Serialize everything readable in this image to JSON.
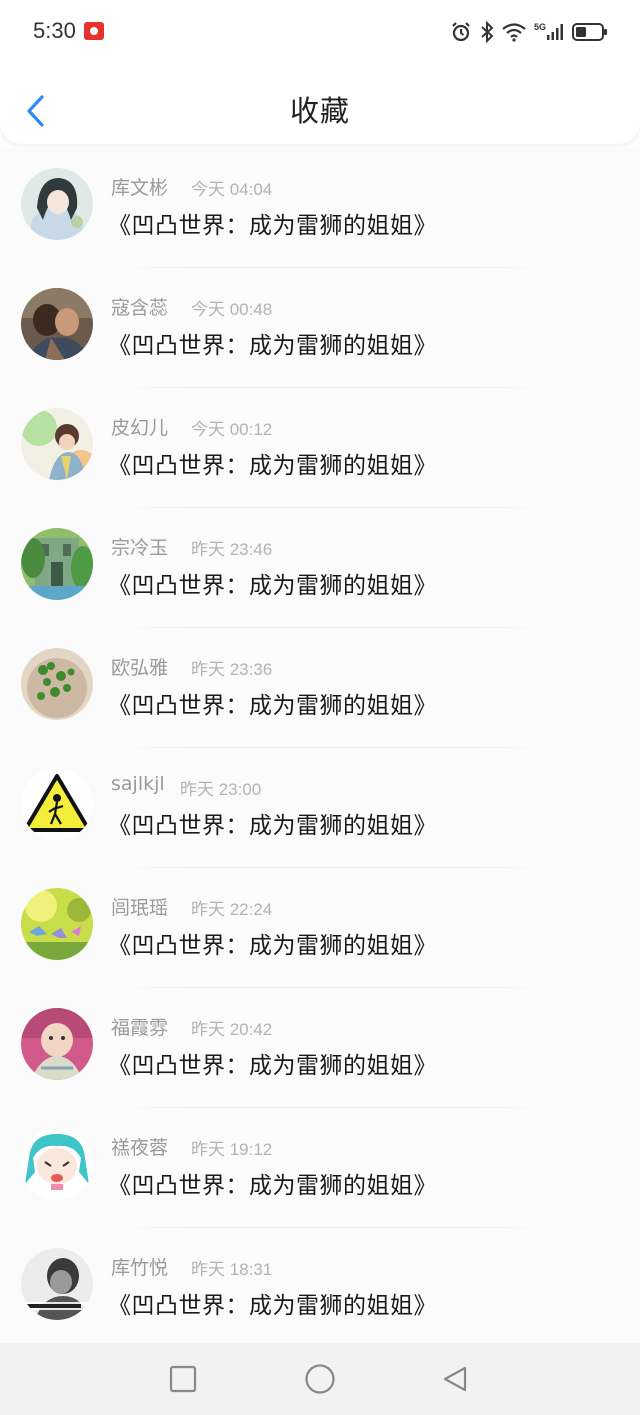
{
  "status_bar": {
    "time": "5:30",
    "network": "5G",
    "icons": [
      "app-notification-icon",
      "alarm-icon",
      "bluetooth-icon",
      "wifi-icon",
      "signal-icon",
      "battery-icon"
    ]
  },
  "header": {
    "title": "收藏",
    "back_icon": "chevron-left-icon",
    "accent_color": "#2d8cf0"
  },
  "favorites": [
    {
      "author": "库文彬",
      "time": "今天 04:04",
      "title": "《凹凸世界：成为雷狮的姐姐》"
    },
    {
      "author": "寇含蕊",
      "time": "今天 00:48",
      "title": "《凹凸世界：成为雷狮的姐姐》"
    },
    {
      "author": "皮幻儿",
      "time": "今天 00:12",
      "title": "《凹凸世界：成为雷狮的姐姐》"
    },
    {
      "author": "宗冷玉",
      "time": "昨天 23:46",
      "title": "《凹凸世界：成为雷狮的姐姐》"
    },
    {
      "author": "欧弘雅",
      "time": "昨天 23:36",
      "title": "《凹凸世界：成为雷狮的姐姐》"
    },
    {
      "author": "sajlkjl",
      "time": "昨天 23:00",
      "title": "《凹凸世界：成为雷狮的姐姐》"
    },
    {
      "author": "闾珉瑶",
      "time": "昨天 22:24",
      "title": "《凹凸世界：成为雷狮的姐姐》"
    },
    {
      "author": "福霞雰",
      "time": "昨天 20:42",
      "title": "《凹凸世界：成为雷狮的姐姐》"
    },
    {
      "author": "禚夜蓉",
      "time": "昨天 19:12",
      "title": "《凹凸世界：成为雷狮的姐姐》"
    },
    {
      "author": "库竹悦",
      "time": "昨天 18:31",
      "title": "《凹凸世界：成为雷狮的姐姐》"
    }
  ],
  "nav_bar": {
    "buttons": [
      "recent-apps-icon",
      "home-icon",
      "back-triangle-icon"
    ]
  }
}
